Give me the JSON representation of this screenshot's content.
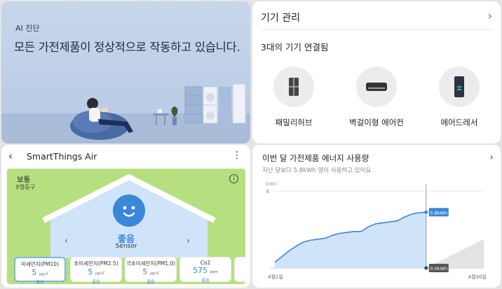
{
  "ai_card": {
    "tag": "AI 진단",
    "message": "모든 가전제품이 정상적으로 작동하고 있습니다."
  },
  "device_card": {
    "title": "기기 관리",
    "subtitle": "3대의 기기 연결됨",
    "devices": [
      {
        "label": "패밀리허브",
        "icon": "refrigerator-icon"
      },
      {
        "label": "벽걸이형 에어컨",
        "icon": "air-conditioner-icon"
      },
      {
        "label": "에어드레서",
        "icon": "airdresser-icon"
      }
    ]
  },
  "air_card": {
    "title": "SmartThings Air",
    "status": "보통",
    "location": "영등구",
    "air_quality": "좋음",
    "sensor_label": "Sensor",
    "tiles": [
      {
        "name": "미세먼지(PM10)",
        "value": "5",
        "unit": "μg/㎥",
        "status": "좋음",
        "selected": true
      },
      {
        "name": "초미세먼지(PM2.5)",
        "value": "5",
        "unit": "μg/㎥",
        "status": "좋음",
        "selected": false
      },
      {
        "name": "극초미세먼지(PM1.0)",
        "value": "5",
        "unit": "μg/㎥",
        "status": "좋음",
        "selected": false
      },
      {
        "name": "Co2",
        "value": "575",
        "unit": "ppm",
        "status": "좋음",
        "selected": false
      }
    ]
  },
  "energy_card": {
    "title": "이번 달 가전제품 에너지 사용량",
    "subtitle": "지난 달보다 5.8kWh 많이 사용하고 있어요",
    "colors": {
      "line": "#3a86d8",
      "fill": "#cfe4f9",
      "grid": "#e8e8e8"
    }
  },
  "chart_data": {
    "type": "area",
    "ylabel": "(kWh)",
    "ylim": [
      0,
      8
    ],
    "y_ticks": [
      "8"
    ],
    "x_start_label": "4월1일",
    "x_end_label": "4월30일",
    "x_range": [
      1,
      30
    ],
    "values": [
      [
        1,
        0.6
      ],
      [
        2,
        1.2
      ],
      [
        3,
        1.8
      ],
      [
        4,
        2.3
      ],
      [
        5,
        2.7
      ],
      [
        6,
        2.9
      ],
      [
        7,
        3.0
      ],
      [
        8,
        3.1
      ],
      [
        9,
        3.4
      ],
      [
        10,
        3.6
      ],
      [
        11,
        3.7
      ],
      [
        12,
        3.8
      ],
      [
        13,
        3.8
      ],
      [
        14,
        4.3
      ],
      [
        15,
        4.6
      ],
      [
        16,
        4.7
      ],
      [
        17,
        4.8
      ],
      [
        18,
        4.9
      ],
      [
        19,
        5.3
      ],
      [
        20,
        5.6
      ],
      [
        21,
        5.75
      ],
      [
        22,
        5.8
      ]
    ],
    "current_label": "5.8kWh",
    "baseline_label": "0.0kWh"
  }
}
